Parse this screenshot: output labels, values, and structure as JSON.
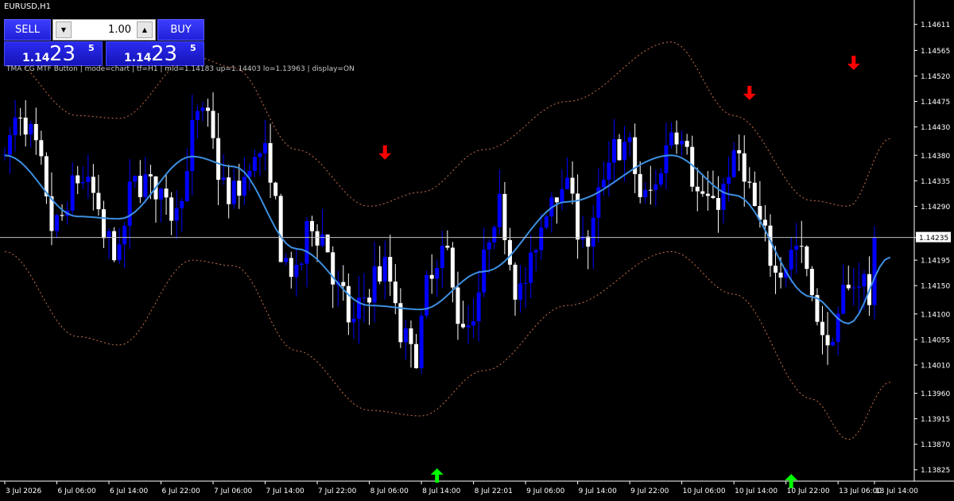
{
  "window": {
    "title": "EURUSD,H1"
  },
  "trade_panel": {
    "sell_label": "SELL",
    "buy_label": "BUY",
    "lot_value": "1.00",
    "down_glyph": "▼",
    "up_glyph": "▲",
    "bid": {
      "big": "1.14",
      "digits": "23",
      "pip": "5"
    },
    "ask": {
      "big": "1.14",
      "digits": "23",
      "pip": "5"
    }
  },
  "indicator_label": "TMA CG MTF Button | mode=chart | tf=H1 | mid=1.14183 up=1.14403 lo=1.13963 | display=ON",
  "colors": {
    "bull": "#0000ff",
    "bear": "#ffffff",
    "mid_line": "#3d8fe0",
    "band": "#c8714a",
    "arrow_down": "#ff0000",
    "arrow_up": "#00ff00",
    "axis": "#ffffff",
    "price_line": "#c0c0c0"
  },
  "chart_data": {
    "type": "candlestick",
    "symbol": "EURUSD",
    "timeframe": "H1",
    "ylim": [
      1.13805,
      1.14633
    ],
    "yticks": [
      "1.14611",
      "1.14565",
      "1.14520",
      "1.14475",
      "1.14430",
      "1.14380",
      "1.14335",
      "1.14290",
      "1.14235",
      "1.14195",
      "1.14150",
      "1.14100",
      "1.14055",
      "1.14010",
      "1.13960",
      "1.13915",
      "1.13870",
      "1.13825"
    ],
    "current_price": 1.14235,
    "current_price_label": "1.14235",
    "xticks": [
      "3 Jul 2026",
      "6 Jul 06:00",
      "6 Jul 14:00",
      "6 Jul 22:00",
      "7 Jul 06:00",
      "7 Jul 14:00",
      "7 Jul 22:00",
      "8 Jul 06:00",
      "8 Jul 14:00",
      "8 Jul 22:01",
      "9 Jul 06:00",
      "9 Jul 14:00",
      "9 Jul 22:00",
      "10 Jul 06:00",
      "10 Jul 14:00",
      "10 Jul 22:00",
      "13 Jul 06:00",
      "13 Jul 14:00"
    ],
    "candle_count": 168,
    "mid_line": [
      [
        0,
        1.1438
      ],
      [
        14,
        1.14272
      ],
      [
        22,
        1.14268
      ],
      [
        36,
        1.14378
      ],
      [
        44,
        1.1436
      ],
      [
        56,
        1.14215
      ],
      [
        70,
        1.14115
      ],
      [
        80,
        1.14108
      ],
      [
        92,
        1.14175
      ],
      [
        108,
        1.14298
      ],
      [
        128,
        1.1438
      ],
      [
        140,
        1.1431
      ],
      [
        155,
        1.1413
      ],
      [
        162,
        1.14083
      ],
      [
        170,
        1.142
      ]
    ],
    "upper_band": [
      [
        0,
        1.14555
      ],
      [
        14,
        1.1445
      ],
      [
        22,
        1.14445
      ],
      [
        36,
        1.14555
      ],
      [
        44,
        1.14535
      ],
      [
        56,
        1.1439
      ],
      [
        70,
        1.1429
      ],
      [
        80,
        1.14315
      ],
      [
        92,
        1.1439
      ],
      [
        108,
        1.14475
      ],
      [
        128,
        1.1458
      ],
      [
        140,
        1.1445
      ],
      [
        155,
        1.143
      ],
      [
        162,
        1.1429
      ],
      [
        170,
        1.1441
      ]
    ],
    "lower_band": [
      [
        0,
        1.1421
      ],
      [
        14,
        1.1406
      ],
      [
        22,
        1.14045
      ],
      [
        36,
        1.14195
      ],
      [
        44,
        1.14185
      ],
      [
        56,
        1.14035
      ],
      [
        70,
        1.1393
      ],
      [
        80,
        1.1392
      ],
      [
        92,
        1.14
      ],
      [
        108,
        1.14115
      ],
      [
        128,
        1.1421
      ],
      [
        140,
        1.14135
      ],
      [
        155,
        1.1395
      ],
      [
        162,
        1.13878
      ],
      [
        170,
        1.1398
      ]
    ],
    "arrows": [
      {
        "index": 73,
        "direction": "down",
        "price": 1.14385
      },
      {
        "index": 83,
        "direction": "up",
        "price": 1.13815
      },
      {
        "index": 143,
        "direction": "down",
        "price": 1.1449
      },
      {
        "index": 163,
        "direction": "down",
        "price": 1.14543
      },
      {
        "index": 151,
        "direction": "up",
        "price": 1.13805
      }
    ]
  }
}
